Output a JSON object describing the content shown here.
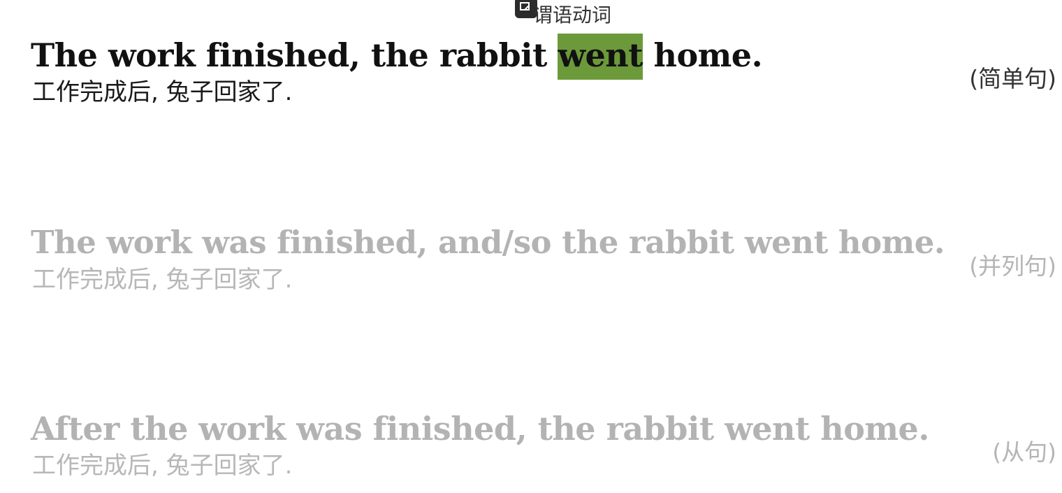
{
  "tooltip": {
    "icon": "screen-icon",
    "label": "谓语动词"
  },
  "sentences": [
    {
      "en_before": "The work finished, the rabbit ",
      "en_highlight": "went",
      "en_after": " home.",
      "zh": "工作完成后, 兔子回家了.",
      "type": "(简单句)",
      "highlight_color": "#6c9a3a"
    },
    {
      "en": "The work was finished, and/so the rabbit went home.",
      "zh": "工作完成后, 兔子回家了.",
      "type": "(并列句)"
    },
    {
      "en": "After the work was finished, the rabbit went home.",
      "zh": "工作完成后, 兔子回家了.",
      "type": "(从句)"
    }
  ]
}
